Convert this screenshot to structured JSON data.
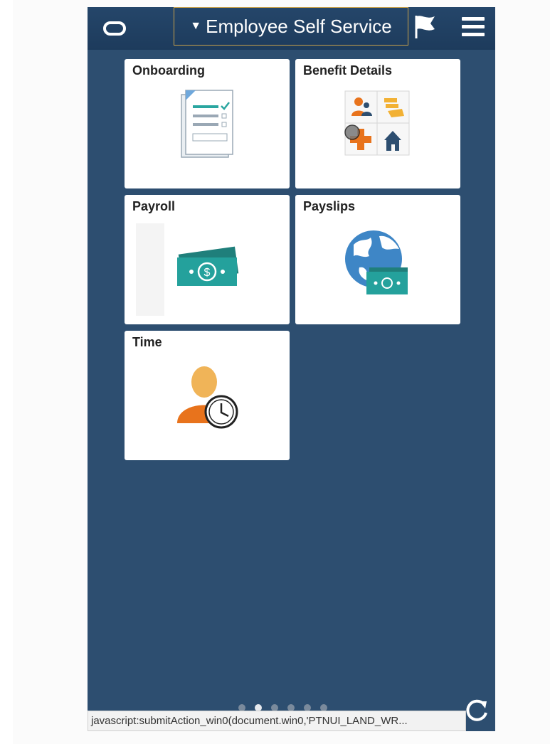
{
  "header": {
    "title": "Employee Self Service",
    "caret_icon": "caret-down-icon",
    "logo_icon": "oracle-logo-icon",
    "flag_icon": "flag-icon",
    "menu_icon": "hamburger-menu-icon"
  },
  "tiles": [
    {
      "title": "Onboarding",
      "icon": "onboarding-checklist-icon"
    },
    {
      "title": "Benefit Details",
      "icon": "benefit-details-icon"
    },
    {
      "title": "Payroll",
      "icon": "payroll-money-icon"
    },
    {
      "title": "Payslips",
      "icon": "payslips-globe-money-icon"
    },
    {
      "title": "Time",
      "icon": "time-person-clock-icon"
    }
  ],
  "pager": {
    "count": 6,
    "active_index": 1
  },
  "status_bar": {
    "text": "javascript:submitAction_win0(document.win0,'PTNUI_LAND_WR..."
  },
  "refresh_icon": "refresh-icon",
  "colors": {
    "background": "#2d4e70",
    "header": "#1d3b5c",
    "title_border": "#c8a14a",
    "tile": "#ffffff",
    "teal": "#1f9c98",
    "orange": "#e8731c"
  }
}
